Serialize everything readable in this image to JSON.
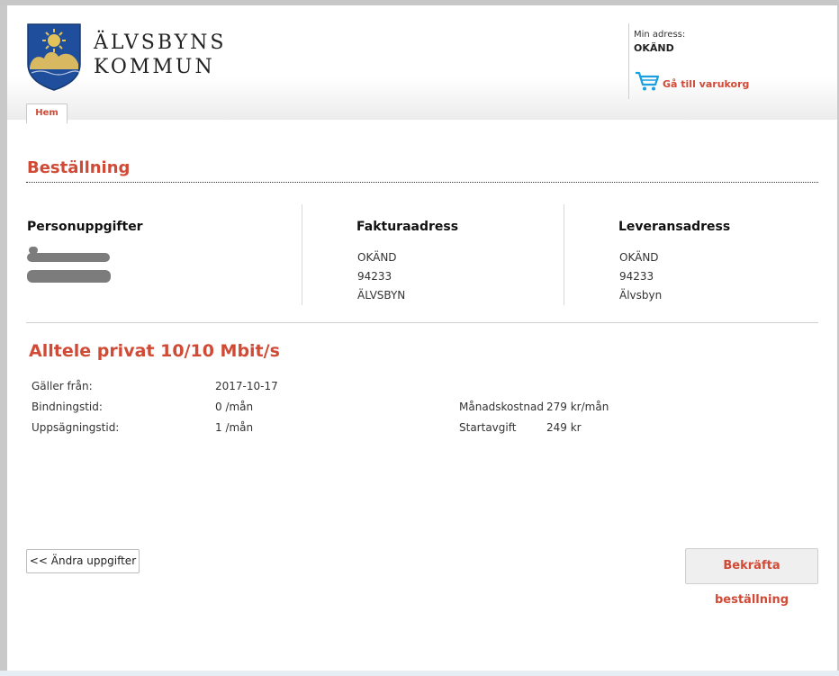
{
  "header": {
    "logo_line1": "ÄLVSBYNS",
    "logo_line2": "KOMMUN",
    "address_label": "Min adress:",
    "address_value": "OKÄND",
    "cart_label": "Gå till varukorg",
    "cart_icon": "shopping-cart-icon",
    "nav_tab": "Hem"
  },
  "order": {
    "title": "Beställning",
    "columns": [
      {
        "heading": "Personuppgifter",
        "lines": []
      },
      {
        "heading": "Fakturaadress",
        "lines": [
          "OKÄND",
          "94233",
          "ÄLVSBYN"
        ]
      },
      {
        "heading": "Leveransadress",
        "lines": [
          "OKÄND",
          "94233",
          "Älvsbyn"
        ]
      }
    ]
  },
  "product": {
    "name": "Alltele privat 10/10 Mbit/s",
    "details": [
      {
        "label": "Gäller från:",
        "value": "2017-10-17"
      },
      {
        "label": "Bindningstid:",
        "value": "0 /mån"
      },
      {
        "label": "Uppsägningstid:",
        "value": "1 /mån"
      }
    ],
    "costs": [
      {
        "label": "Månadskostnad",
        "value": "279 kr/mån"
      },
      {
        "label": "Startavgift",
        "value": "249 kr"
      }
    ]
  },
  "actions": {
    "back_label": "<< Ändra uppgifter",
    "confirm_label": "Bekräfta beställning"
  },
  "colors": {
    "accent": "#d04a36",
    "cart_icon": "#1a9fe0",
    "shield_blue": "#1f4f9c",
    "shield_gold": "#d8b860"
  }
}
